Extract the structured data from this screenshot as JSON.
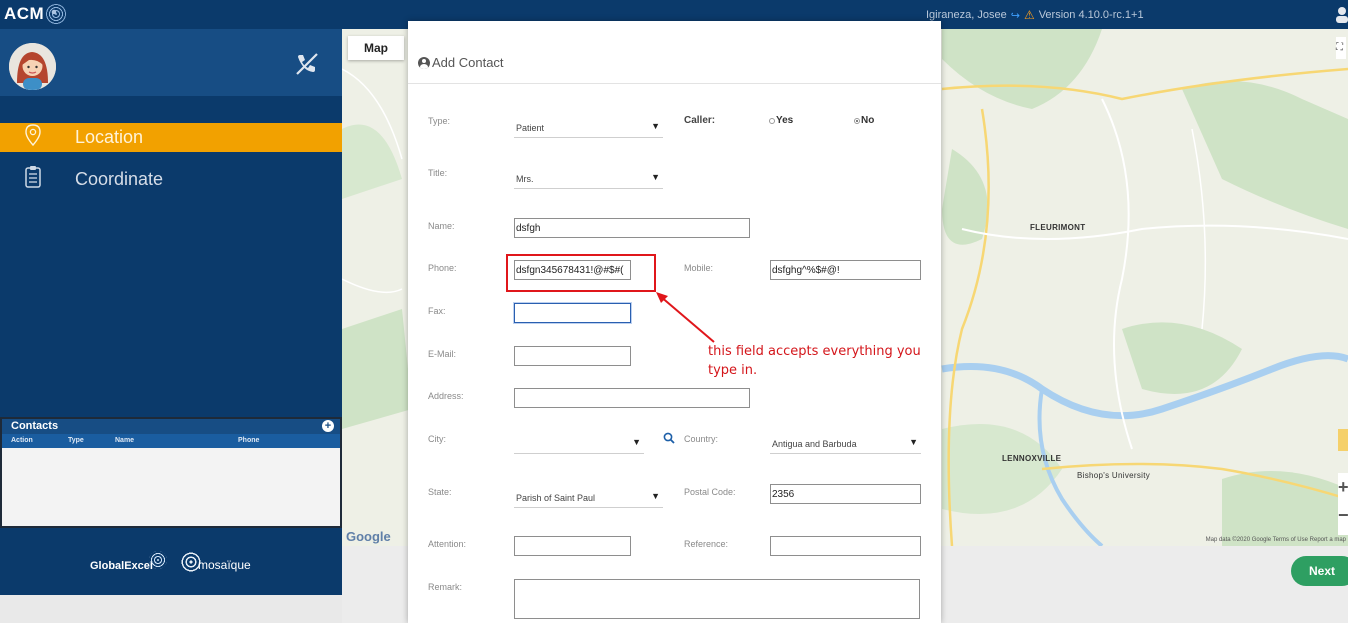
{
  "topbar": {
    "brand": "ACM",
    "user_name": "Igiraneza, Josee",
    "version": "Version 4.10.0-rc.1+1",
    "bg_color": "#0b3a6b"
  },
  "sidebar": {
    "nav": [
      {
        "label": "Location",
        "icon": "map-pin-icon",
        "active": true
      },
      {
        "label": "Coordinate",
        "icon": "clipboard-icon",
        "active": false
      }
    ],
    "contacts": {
      "title": "Contacts",
      "columns": [
        "Action",
        "Type",
        "Name",
        "Phone"
      ]
    },
    "logos": {
      "globalexcel": "GlobalExcel",
      "mosaique": "mosaïque"
    },
    "accent_color": "#f2a100"
  },
  "map": {
    "tab_label": "Map",
    "google_logo": "Google",
    "attribution": "Map data ©2020 Google   Terms of Use   Report a map",
    "labels": {
      "fleurimont": "FLEURIMONT",
      "lennoxville": "LENNOXVILLE",
      "bishops": "Bishop's University"
    }
  },
  "next_button": {
    "label": "Next",
    "color": "#2e9f62"
  },
  "modal": {
    "title": "Add Contact",
    "fields": {
      "type": {
        "label": "Type:",
        "value": "Patient"
      },
      "caller": {
        "label": "Caller:",
        "yes": "Yes",
        "no": "No",
        "selected": "No"
      },
      "title": {
        "label": "Title:",
        "value": "Mrs."
      },
      "name": {
        "label": "Name:",
        "value": "dsfgh"
      },
      "phone": {
        "label": "Phone:",
        "value": "dsfgn345678431!@#$#("
      },
      "mobile": {
        "label": "Mobile:",
        "value": "dsfghg^%$#@!"
      },
      "fax": {
        "label": "Fax:",
        "value": ""
      },
      "email": {
        "label": "E-Mail:",
        "value": ""
      },
      "address": {
        "label": "Address:",
        "value": ""
      },
      "city": {
        "label": "City:",
        "value": ""
      },
      "country": {
        "label": "Country:",
        "value": "Antigua and Barbuda"
      },
      "state": {
        "label": "State:",
        "value": "Parish of Saint Paul"
      },
      "postal_code": {
        "label": "Postal Code:",
        "value": "2356"
      },
      "attention": {
        "label": "Attention:",
        "value": ""
      },
      "reference": {
        "label": "Reference:",
        "value": ""
      },
      "remark": {
        "label": "Remark:",
        "value": ""
      }
    }
  },
  "annotation": {
    "text": "this field accepts everything you type in.",
    "color": "#d4161b"
  }
}
